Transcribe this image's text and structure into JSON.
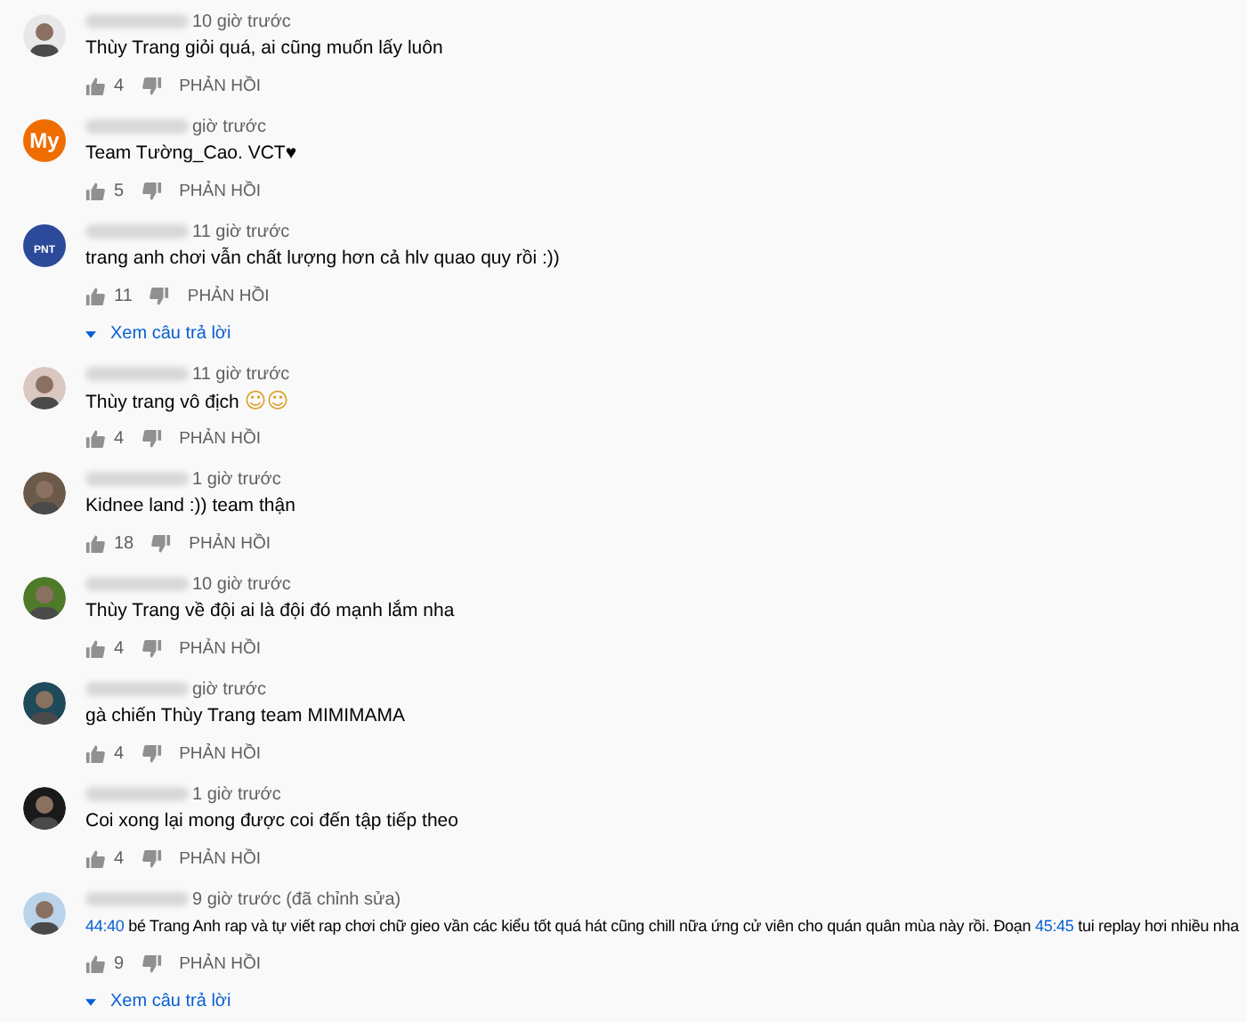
{
  "comments": [
    {
      "avatar": {
        "kind": "picture"
      },
      "time": "10 giờ trước",
      "text": [
        {
          "kind": "text",
          "value": "Thùy Trang giỏi quá, ai cũng muốn lấy luôn"
        }
      ],
      "likes": "4",
      "reply": "PHẢN HỒI"
    },
    {
      "avatar": {
        "kind": "letter",
        "color": "#ef6c00",
        "letters": "My"
      },
      "time": "giờ trước",
      "text": [
        {
          "kind": "text",
          "value": "Team Tường_Cao. VCT♥"
        }
      ],
      "likes": "5",
      "reply": "PHẢN HỒI"
    },
    {
      "avatar": {
        "kind": "logo",
        "color": "#2b4a9a",
        "letters": "PNT"
      },
      "time": "11 giờ trước",
      "text": [
        {
          "kind": "text",
          "value": "trang anh chơi vẫn chất lượng hơn cả hlv quao quy rồi :))"
        }
      ],
      "likes": "11",
      "reply": "PHẢN HỒI",
      "replies_link": "Xem câu trả lời"
    },
    {
      "avatar": {
        "kind": "picture"
      },
      "time": "11 giờ trước",
      "text": [
        {
          "kind": "text",
          "value": "Thùy trang vô địch "
        },
        {
          "kind": "emoji",
          "value": "☺☺"
        }
      ],
      "likes": "4",
      "reply": "PHẢN HỒI"
    },
    {
      "avatar": {
        "kind": "picture"
      },
      "time": "1 giờ trước",
      "text": [
        {
          "kind": "text",
          "value": "Kidnee land :)) team thận"
        }
      ],
      "likes": "18",
      "reply": "PHẢN HỒI"
    },
    {
      "avatar": {
        "kind": "picture"
      },
      "time": "10 giờ trước",
      "text": [
        {
          "kind": "text",
          "value": "Thùy Trang về đội ai là đội đó mạnh lắm nha"
        }
      ],
      "likes": "4",
      "reply": "PHẢN HỒI"
    },
    {
      "avatar": {
        "kind": "picture"
      },
      "time": "giờ trước",
      "text": [
        {
          "kind": "text",
          "value": "gà chiến Thùy Trang team MIMIMAMA"
        }
      ],
      "likes": "4",
      "reply": "PHẢN HỒI"
    },
    {
      "avatar": {
        "kind": "picture"
      },
      "time": "1 giờ trước",
      "text": [
        {
          "kind": "text",
          "value": "Coi xong lại mong được coi đến tập tiếp theo"
        }
      ],
      "likes": "4",
      "reply": "PHẢN HỒI"
    },
    {
      "avatar": {
        "kind": "picture"
      },
      "time": "9 giờ trước (đã chỉnh sửa)",
      "text": [
        {
          "kind": "timestamp",
          "value": "44:40"
        },
        {
          "kind": "text",
          "value": " bé Trang Anh rap và tự viết rap chơi chữ gieo vần các kiểu tốt quá hát cũng chill nữa ứng cử viên cho quán quân mùa này rồi. Đoạn "
        },
        {
          "kind": "timestamp",
          "value": "45:45"
        },
        {
          "kind": "text",
          "value": " tui replay hơi nhiều nha"
        }
      ],
      "likes": "9",
      "reply": "PHẢN HỒI",
      "replies_link": "Xem câu trả lời"
    }
  ]
}
